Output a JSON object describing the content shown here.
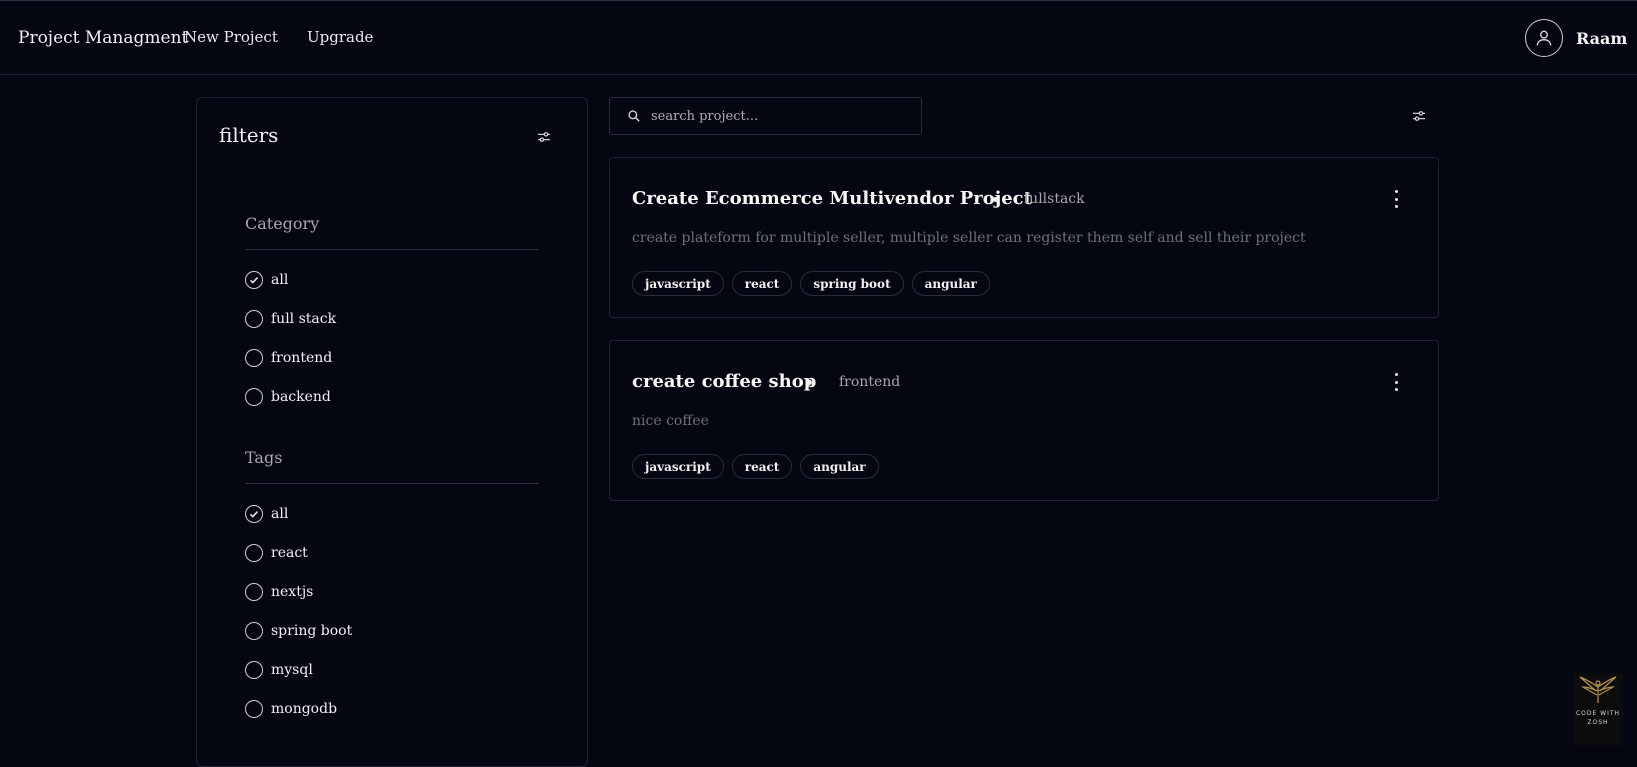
{
  "header": {
    "brand": "Project Managment",
    "nav": {
      "new_project": "New Project",
      "upgrade": "Upgrade"
    },
    "user": {
      "name": "Raam",
      "avatar_icon": "user-icon"
    }
  },
  "sidebar": {
    "title": "filters",
    "filter_icon": "sliders-icon",
    "category": {
      "title": "Category",
      "options": [
        "all",
        "full stack",
        "frontend",
        "backend"
      ],
      "selected": "all"
    },
    "tags": {
      "title": "Tags",
      "options": [
        "all",
        "react",
        "nextjs",
        "spring boot",
        "mysql",
        "mongodb"
      ],
      "selected": "all"
    }
  },
  "search": {
    "placeholder": "search project...",
    "value": "",
    "icon": "search-icon",
    "filter_icon": "sliders-icon"
  },
  "projects": [
    {
      "title": "Create Ecommerce Multivendor Project",
      "category": "fullstack",
      "description": "create plateform for multiple seller, multiple seller can register them self and sell their project",
      "tags": [
        "javascript",
        "react",
        "spring boot",
        "angular"
      ]
    },
    {
      "title": "create coffee shop",
      "category": "frontend",
      "description": "nice coffee",
      "tags": [
        "javascript",
        "react",
        "angular"
      ]
    }
  ],
  "watermark": {
    "line1": "CODE WITH",
    "line2": "ZOSH"
  },
  "colors": {
    "background": "#040712",
    "border": "#1e2434",
    "muted_text": "#a9a9a9",
    "description_text": "#6d7078"
  }
}
